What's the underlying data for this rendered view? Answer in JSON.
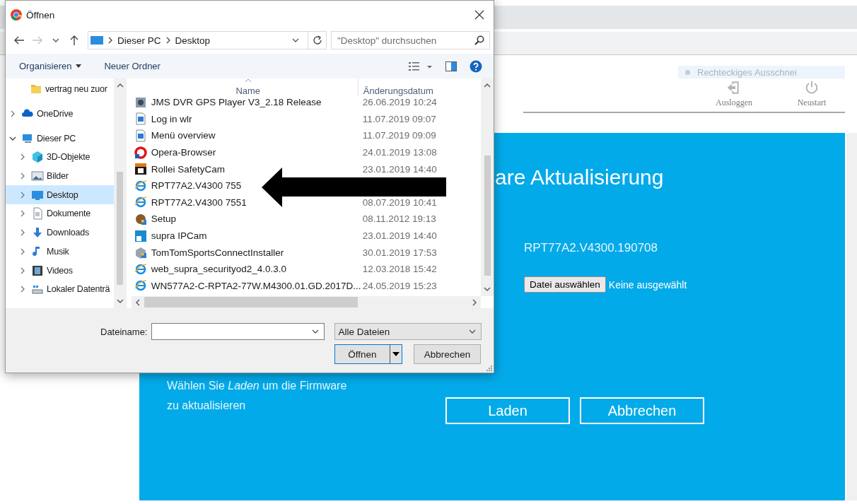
{
  "browser": {
    "snip_hint": "Rechteckiges Ausschnei",
    "header_buttons": [
      {
        "label": "Ausloggen",
        "kind": "logout"
      },
      {
        "label": "Neustart",
        "kind": "restart"
      }
    ]
  },
  "firmware_panel": {
    "title": "are Aktualisierung",
    "version": "RPT77A2.V4300.190708",
    "file_button": "Datei auswählen",
    "file_status": "Keine ausgewählt",
    "instruction": "Wählen Sie *Laden* um die Firmware zu aktualisieren",
    "buttons": [
      "Laden",
      "Abbrechen"
    ]
  },
  "dialog": {
    "title": "Öffnen",
    "path": [
      "Dieser PC",
      "Desktop"
    ],
    "search_placeholder": "\"Desktop\" durchsuchen",
    "toolbar": [
      "Organisieren",
      "Neuer Ordner"
    ],
    "nav": [
      {
        "label": "vertrag neu zuor",
        "kind": "folder",
        "selected": false
      },
      {
        "label": "OneDrive",
        "kind": "cloud",
        "expanded": false,
        "selected": false
      },
      {
        "label": "Dieser PC",
        "kind": "pc",
        "expanded": true,
        "selected": false,
        "children": [
          {
            "label": "3D-Objekte",
            "kind": "cube",
            "expanded": false,
            "selected": false
          },
          {
            "label": "Bilder",
            "kind": "pictures",
            "expanded": false,
            "selected": false
          },
          {
            "label": "Desktop",
            "kind": "desktop",
            "expanded": false,
            "selected": true
          },
          {
            "label": "Dokumente",
            "kind": "document",
            "expanded": false,
            "selected": false
          },
          {
            "label": "Downloads",
            "kind": "download",
            "expanded": false,
            "selected": false
          },
          {
            "label": "Musik",
            "kind": "music",
            "expanded": false,
            "selected": false
          },
          {
            "label": "Videos",
            "kind": "video",
            "expanded": false,
            "selected": false
          },
          {
            "label": "Lokaler Datenträ",
            "kind": "drive",
            "expanded": false,
            "selected": false
          }
        ]
      }
    ],
    "columns": [
      "Name",
      "Änderungsdatum"
    ],
    "files": [
      {
        "name": "JMS DVR GPS Player V3_2.18 Release",
        "date": "26.06.2019 10:24",
        "kind": "app"
      },
      {
        "name": "Log in wlr",
        "date": "11.07.2019 09:07",
        "kind": "image"
      },
      {
        "name": "Menü overview",
        "date": "11.07.2019 09:09",
        "kind": "image"
      },
      {
        "name": "Opera-Browser",
        "date": "24.01.2019 13:08",
        "kind": "opera"
      },
      {
        "name": "Rollei SafetyCam",
        "date": "23.01.2019 14:40",
        "kind": "camera"
      },
      {
        "name": "RPT77A2.V4300 755",
        "kind": "web"
      },
      {
        "name": "RPT77A2.V4300 7551",
        "date": "08.07.2019 10:41",
        "kind": "web"
      },
      {
        "name": "Setup",
        "date": "08.11.2012 19:13",
        "kind": "setup"
      },
      {
        "name": "supra IPCam",
        "date": "23.01.2019 14:40",
        "kind": "shortcut"
      },
      {
        "name": "TomTomSportsConnectInstaller",
        "date": "30.01.2019 17:53",
        "kind": "installer"
      },
      {
        "name": "web_supra_securityod2_4.0.3.0",
        "date": "12.03.2018 15:42",
        "kind": "web"
      },
      {
        "name": "WN577A2-C-RPTA2-77W.M4300.01.GD.2017D...",
        "date": "24.05.2019 15:23",
        "kind": "web"
      }
    ],
    "filename_label": "Dateiname:",
    "filter": "Alle Dateien",
    "buttons": [
      "Öffnen",
      "Abbrechen"
    ]
  }
}
